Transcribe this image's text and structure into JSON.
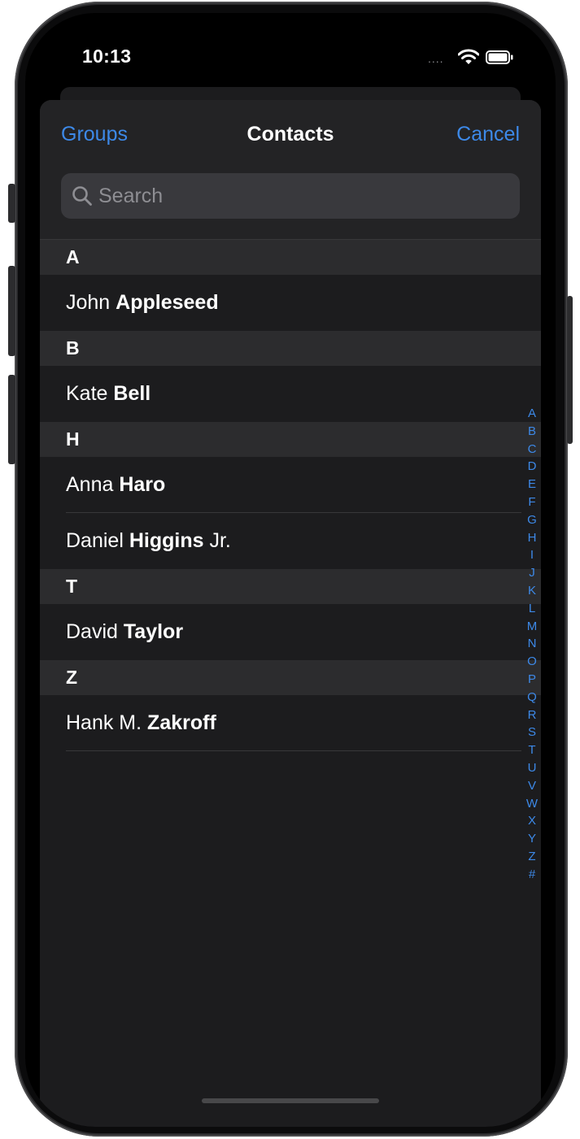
{
  "status_bar": {
    "time": "10:13",
    "signal_dots": "....",
    "icons": [
      "wifi-icon",
      "battery-icon"
    ]
  },
  "nav": {
    "left_label": "Groups",
    "title": "Contacts",
    "right_label": "Cancel"
  },
  "search": {
    "placeholder": "Search",
    "value": "",
    "icon": "search-icon"
  },
  "sections": [
    {
      "letter": "A",
      "contacts": [
        {
          "first": "John",
          "last": "Appleseed",
          "suffix": ""
        }
      ]
    },
    {
      "letter": "B",
      "contacts": [
        {
          "first": "Kate",
          "last": "Bell",
          "suffix": ""
        }
      ]
    },
    {
      "letter": "H",
      "contacts": [
        {
          "first": "Anna",
          "last": "Haro",
          "suffix": ""
        },
        {
          "first": "Daniel",
          "last": "Higgins",
          "suffix": "Jr."
        }
      ]
    },
    {
      "letter": "T",
      "contacts": [
        {
          "first": "David",
          "last": "Taylor",
          "suffix": ""
        }
      ]
    },
    {
      "letter": "Z",
      "contacts": [
        {
          "first": "Hank M.",
          "last": "Zakroff",
          "suffix": ""
        }
      ]
    }
  ],
  "index_letters": [
    "A",
    "B",
    "C",
    "D",
    "E",
    "F",
    "G",
    "H",
    "I",
    "J",
    "K",
    "L",
    "M",
    "N",
    "O",
    "P",
    "Q",
    "R",
    "S",
    "T",
    "U",
    "V",
    "W",
    "X",
    "Y",
    "Z",
    "#"
  ],
  "colors": {
    "accent": "#3d89e8",
    "background": "#1c1c1e",
    "section_header": "#2c2c2e",
    "text": "#ffffff",
    "placeholder": "#8e8e93"
  }
}
